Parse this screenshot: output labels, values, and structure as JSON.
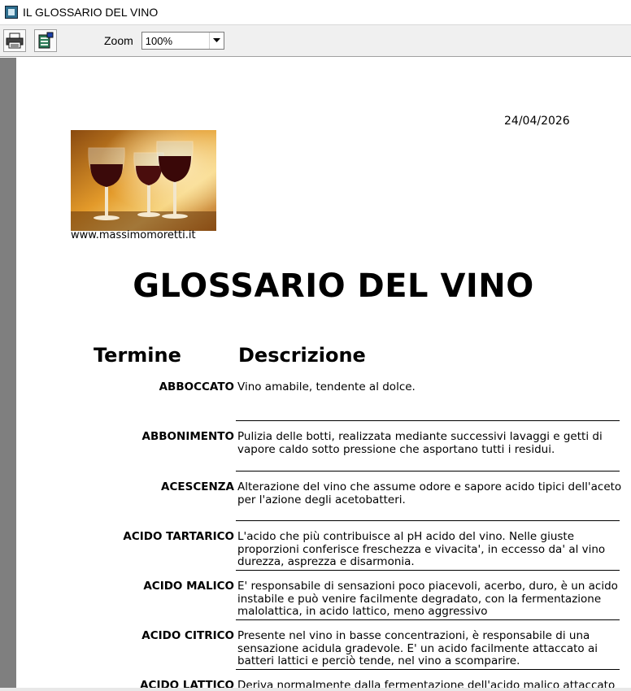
{
  "window": {
    "title": "IL GLOSSARIO DEL VINO"
  },
  "toolbar": {
    "zoom_label": "Zoom",
    "zoom_value": "100%"
  },
  "document": {
    "date": "24/04/2026",
    "website": "www.massimomoretti.it",
    "title": "GLOSSARIO DEL VINO",
    "col_term": "Termine",
    "col_desc": "Descrizione",
    "entries": [
      {
        "term": "ABBOCCATO",
        "desc": "Vino amabile, tendente al dolce."
      },
      {
        "term": "ABBONIMENTO",
        "desc": "Pulizia delle botti, realizzata mediante successivi lavaggi e getti di vapore caldo sotto pressione che asportano tutti i residui."
      },
      {
        "term": "ACESCENZA",
        "desc": "Alterazione del vino che assume odore e sapore acido tipici dell'aceto per l'azione degli acetobatteri."
      },
      {
        "term": "ACIDO TARTARICO",
        "desc": "L'acido che più contribuisce al pH acido del vino. Nelle giuste proporzioni conferisce freschezza e vivacita', in eccesso da' al vino durezza, asprezza e disarmonia."
      },
      {
        "term": "ACIDO MALICO",
        "desc": "E' responsabile di sensazioni poco piacevoli, acerbo, duro, è un acido instabile e può venire facilmente degradato, con la fermentazione malolattica, in acido lattico, meno aggressivo"
      },
      {
        "term": "ACIDO CITRICO",
        "desc": "Presente nel vino in basse concentrazioni, è responsabile di una sensazione acidula gradevole. E' un acido facilmente attaccato ai batteri lattici e perciò tende, nel vino a scomparire."
      },
      {
        "term": "ACIDO LATTICO",
        "desc": "Deriva normalmente dalla fermentazione dell'acido malico attaccato"
      }
    ]
  }
}
